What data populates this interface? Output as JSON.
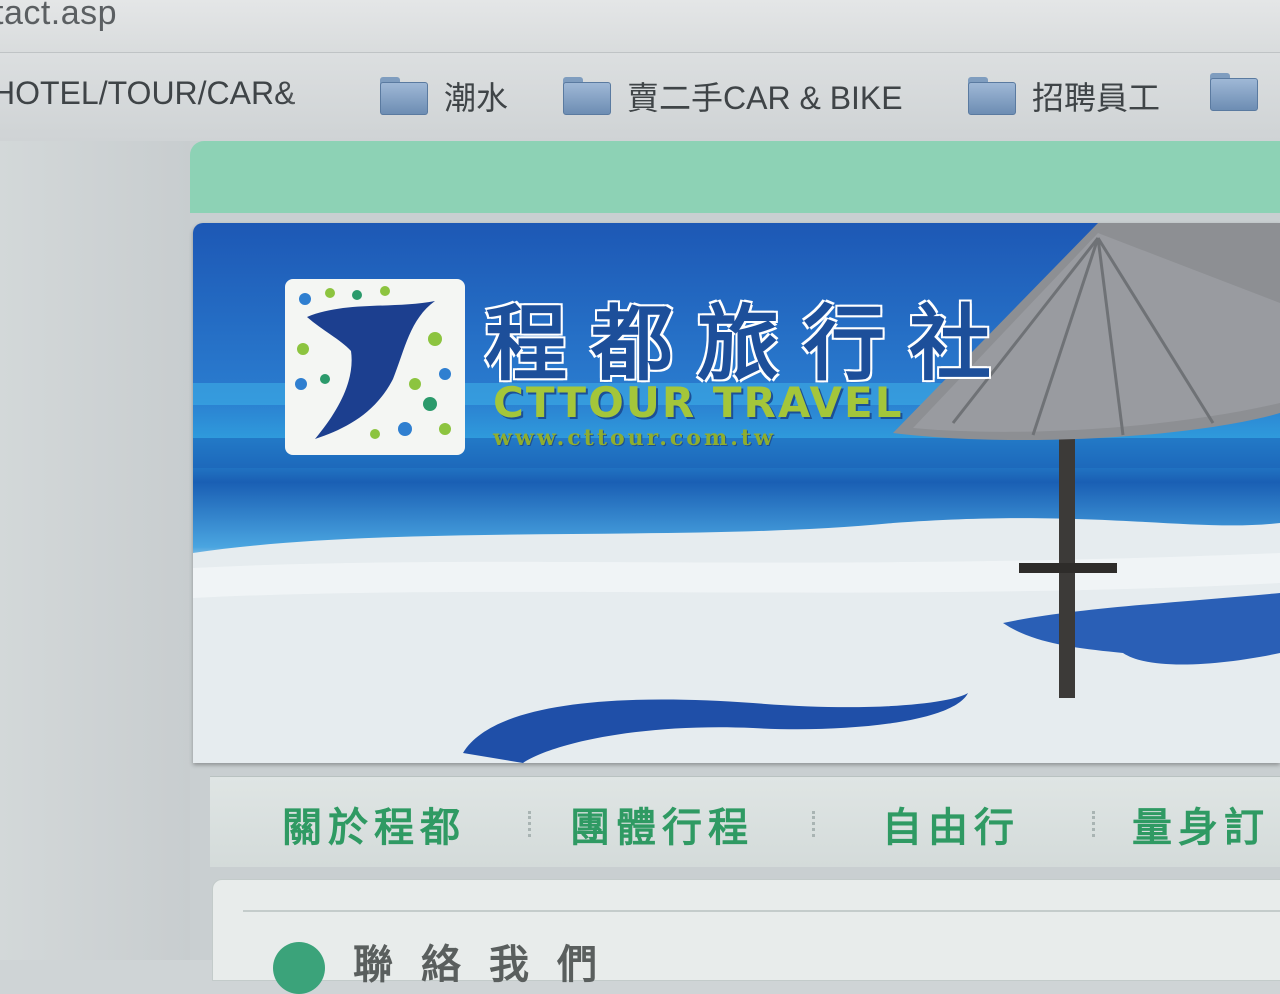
{
  "browser": {
    "url_fragment": "tact.asp",
    "bookmarks": [
      {
        "label": "HOTEL/TOUR/CAR&",
        "has_folder_icon": false
      },
      {
        "label": "潮水",
        "has_folder_icon": true
      },
      {
        "label": "賣二手CAR & BIKE",
        "has_folder_icon": true
      },
      {
        "label": "招聘員工",
        "has_folder_icon": true
      },
      {
        "label": "",
        "has_folder_icon": true
      }
    ]
  },
  "banner": {
    "brand_zh": "程都旅行社",
    "brand_en": "CTTOUR TRAVEL",
    "brand_url": "www.cttour.com.tw"
  },
  "nav": {
    "items": [
      "關於程都",
      "團體行程",
      "自由行",
      "量身訂"
    ]
  },
  "content": {
    "section_title": "聯絡我們"
  },
  "colors": {
    "strip_green": "#8dd2b5",
    "nav_green": "#2f9a63",
    "brand_blue": "#1d4f9a",
    "brand_lime": "#a4c63a"
  }
}
